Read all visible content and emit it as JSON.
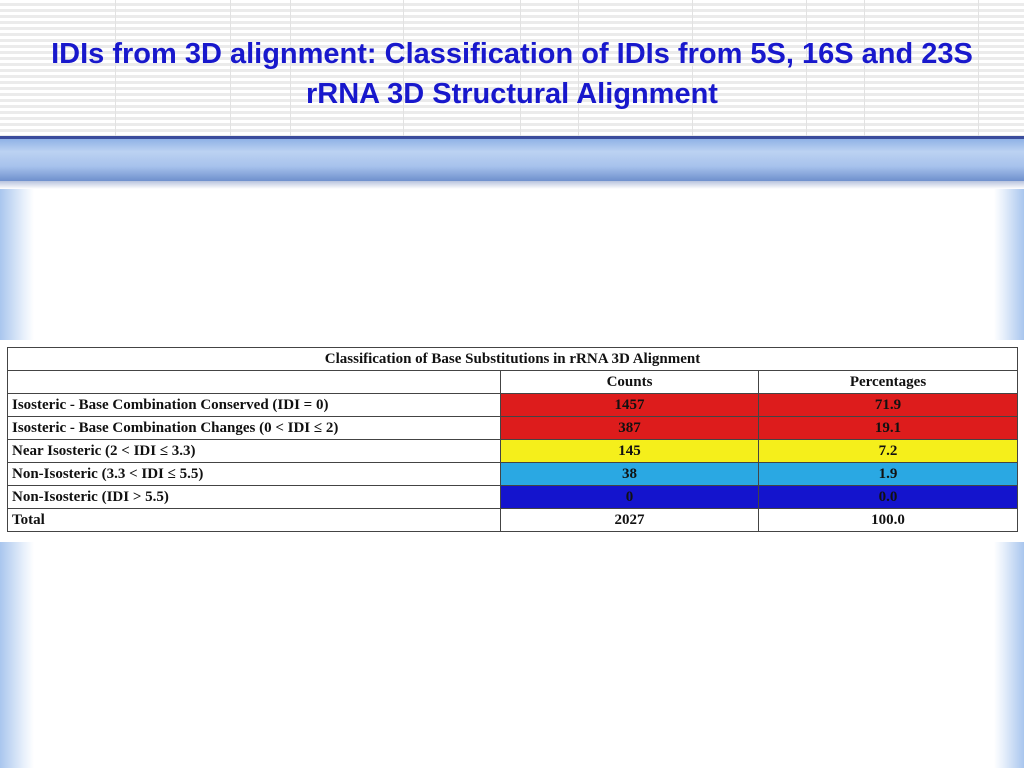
{
  "slide": {
    "title": "IDIs from 3D alignment: Classification of IDIs from 5S, 16S and 23S rRNA 3D Structural Alignment"
  },
  "table": {
    "caption": "Classification of Base Substitutions in rRNA 3D Alignment",
    "columns": [
      "",
      "Counts",
      "Percentages"
    ],
    "rows": [
      {
        "label": "Isosteric - Base Combination Conserved (IDI = 0)",
        "count": "1457",
        "percent": "71.9",
        "color": "#dd1c1c"
      },
      {
        "label": "Isosteric - Base Combination Changes (0 < IDI ≤  2)",
        "count": "387",
        "percent": "19.1",
        "color": "#dd1c1c"
      },
      {
        "label": "Near Isosteric  (2 < IDI ≤ 3.3)",
        "count": "145",
        "percent": "7.2",
        "color": "#f5ef1b"
      },
      {
        "label": "Non-Isosteric (3.3 < IDI ≤ 5.5)",
        "count": "38",
        "percent": "1.9",
        "color": "#2aa8e3"
      },
      {
        "label": "Non-Isosteric (IDI > 5.5)",
        "count": "0",
        "percent": "0.0",
        "color": "#1414cd"
      }
    ],
    "total": {
      "label": "Total",
      "count": "2027",
      "percent": "100.0"
    }
  },
  "colors": {
    "title": "#1818cc",
    "band": "#a7c2ec"
  }
}
